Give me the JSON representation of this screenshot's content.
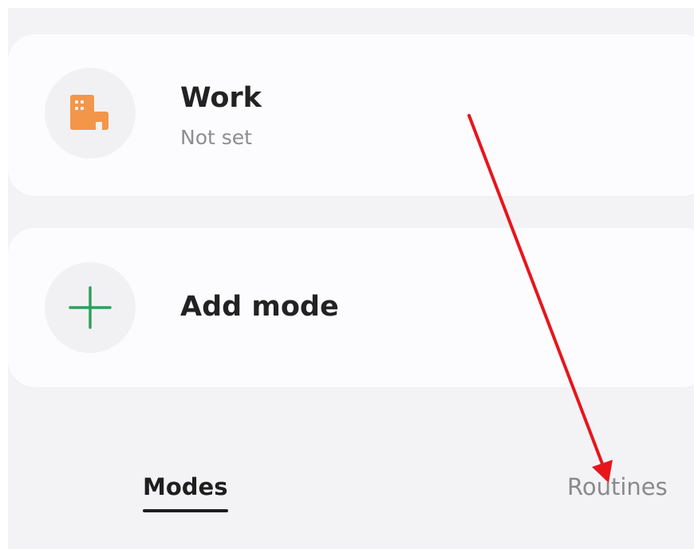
{
  "modes": [
    {
      "label": "Work",
      "subtitle": "Not set",
      "icon": "building-icon",
      "icon_color": "#f3964a"
    },
    {
      "label": "Add mode",
      "icon": "plus-icon",
      "icon_color": "#2e9d5c"
    }
  ],
  "tabs": {
    "modes_label": "Modes",
    "routines_label": "Routines",
    "selected": "Modes"
  },
  "colors": {
    "background": "#f3f3f6",
    "card": "#fcfcfe",
    "icon_circle": "#f1f1f3",
    "annotation_arrow": "#e8151c"
  },
  "annotation": {
    "icon": "red-arrow-icon",
    "points_to": "Routines"
  }
}
